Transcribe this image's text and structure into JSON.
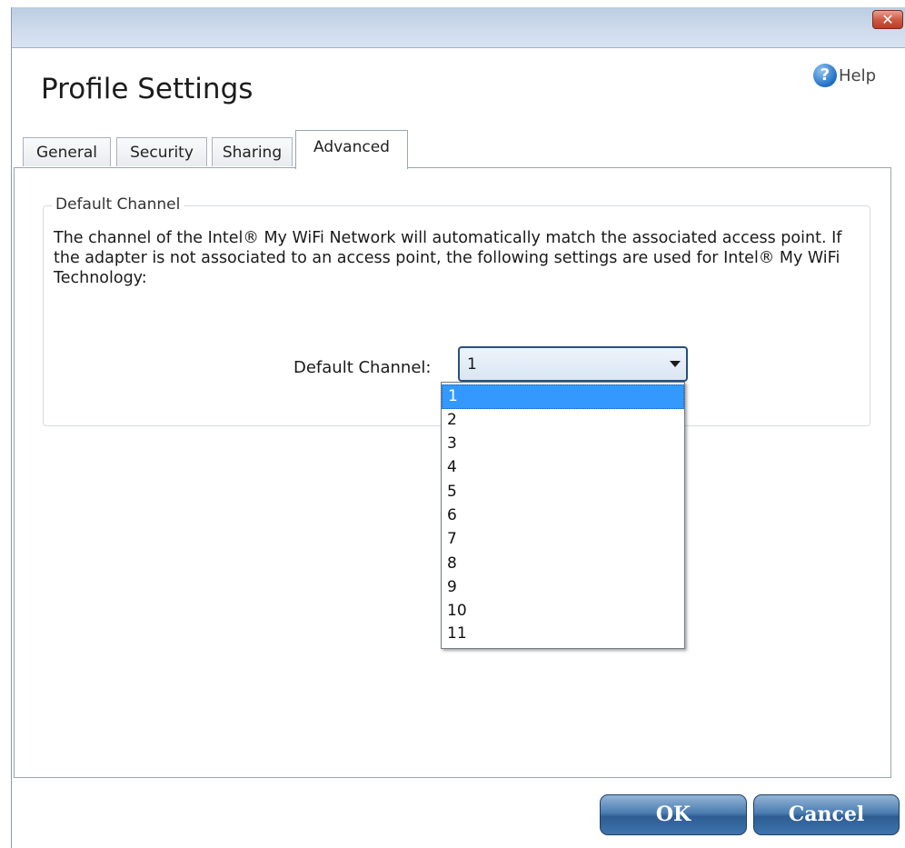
{
  "window": {
    "close_glyph": "✕",
    "title": "Profile Settings",
    "help_label": "Help",
    "help_glyph": "?"
  },
  "tabs": [
    {
      "label": "General",
      "active": false
    },
    {
      "label": "Security",
      "active": false
    },
    {
      "label": "Sharing",
      "active": false
    },
    {
      "label": "Advanced",
      "active": true
    }
  ],
  "group": {
    "legend": "Default Channel",
    "description": "The channel of the Intel® My WiFi Network will automatically match the associated access point. If the adapter is not associated to an access point, the following settings are used for Intel® My WiFi Technology:"
  },
  "channel": {
    "label": "Default Channel:",
    "selected": "1",
    "options": [
      "1",
      "2",
      "3",
      "4",
      "5",
      "6",
      "7",
      "8",
      "9",
      "10",
      "11"
    ]
  },
  "buttons": {
    "ok_label": "OK",
    "cancel_label": "Cancel"
  },
  "icons": {
    "close": "close-icon",
    "help": "help-icon",
    "dropdown": "chevron-down-icon"
  },
  "colors": {
    "selection": "#3399ff",
    "button_blue": "#2d5d93",
    "close_red": "#cf5b45"
  }
}
